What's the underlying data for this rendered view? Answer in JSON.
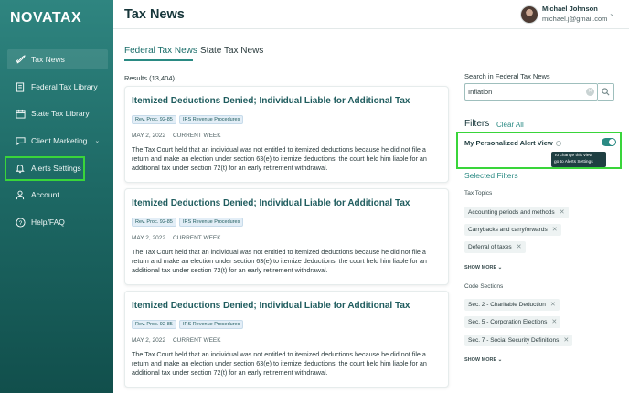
{
  "app": {
    "logo": "NOVATAX"
  },
  "sidebar": {
    "items": [
      {
        "label": "Tax News",
        "icon": "rocket-icon"
      },
      {
        "label": "Federal Tax Library",
        "icon": "document-icon"
      },
      {
        "label": "State Tax Library",
        "icon": "calendar-icon"
      },
      {
        "label": "Client Marketing",
        "icon": "chat-icon",
        "chevron": "⌄"
      },
      {
        "label": "Alerts Settings",
        "icon": "bell-icon"
      },
      {
        "label": "Account",
        "icon": "user-icon"
      },
      {
        "label": "Help/FAQ",
        "icon": "help-icon"
      }
    ]
  },
  "header": {
    "title": "Tax News",
    "user_name": "Michael Johnson",
    "user_email": "michael.j@gmail.com"
  },
  "tabs": [
    {
      "label": "Federal Tax News",
      "active": true
    },
    {
      "label": "State Tax News",
      "active": false
    }
  ],
  "results": {
    "label": "Results (13,404)"
  },
  "articles": [
    {
      "title": "Itemized Deductions Denied; Individual Liable for Additional Tax",
      "tags": [
        "Rev. Proc. 92-85",
        "IRS Revenue Procedures"
      ],
      "date": "MAY 2, 2022",
      "status": "CURRENT WEEK",
      "body": "The Tax Court held that an individual was not entitled to itemized deductions because he did not file a return and make an election under section 63(e) to itemize deductions; the court held him liable for an additional tax under section 72(t) for an early retirement withdrawal."
    },
    {
      "title": "Itemized Deductions Denied; Individual Liable for Additional Tax",
      "tags": [
        "Rev. Proc. 92-85",
        "IRS Revenue Procedures"
      ],
      "date": "MAY 2, 2022",
      "status": "CURRENT WEEK",
      "body": "The Tax Court held that an individual was not entitled to itemized deductions because he did not file a return and make an election under section 63(e) to itemize deductions; the court held him liable for an additional tax under section 72(t) for an early retirement withdrawal."
    },
    {
      "title": "Itemized Deductions Denied; Individual Liable for Additional Tax",
      "tags": [
        "Rev. Proc. 92-85",
        "IRS Revenue Procedures"
      ],
      "date": "MAY 2, 2022",
      "status": "CURRENT WEEK",
      "body": "The Tax Court held that an individual was not entitled to itemized deductions because he did not file a return and make an election under section 63(e) to itemize deductions; the court held him liable for an additional tax under section 72(t) for an early retirement withdrawal."
    }
  ],
  "search": {
    "label": "Search in Federal Tax News",
    "value": "Inflation"
  },
  "filters": {
    "title": "Filters",
    "clear_all": "Clear All",
    "alert_view_label": "My Personalized Alert View",
    "alert_view_enabled": true,
    "tooltip_line1": "To change this view",
    "tooltip_line2": "go to Alerts Settings",
    "selected_title": "Selected Filters",
    "tax_topics_label": "Tax Topics",
    "tax_topics": [
      "Accounting periods and methods",
      "Carrybacks and carryforwards",
      "Deferral of taxes"
    ],
    "code_sections_label": "Code Sections",
    "code_sections": [
      "Sec. 2 - Charitable Deduction",
      "Sec. 5 - Corporation Elections",
      "Sec. 7 - Social Security Definitions"
    ],
    "show_more": "SHOW MORE"
  },
  "colors": {
    "accent": "#2a8a83",
    "sidebar_top": "#2f8580",
    "sidebar_bottom": "#114f4c",
    "highlight": "#39d53a"
  }
}
